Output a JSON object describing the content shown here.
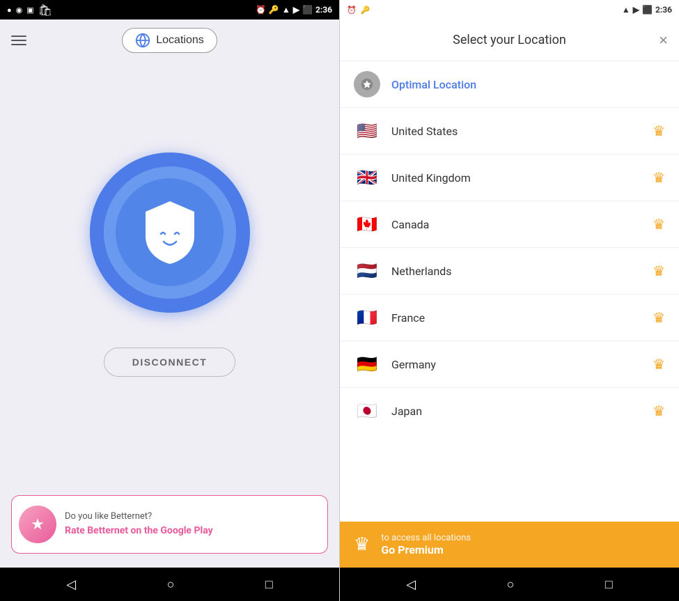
{
  "statusBar": {
    "time": "2:36",
    "leftIcons": [
      "●",
      "◉",
      "▣",
      "🛍"
    ],
    "rightIcons": [
      "⏰",
      "🔑",
      "▲",
      "▶",
      "⬛",
      "2:36"
    ]
  },
  "leftPanel": {
    "title": "Locations",
    "disconnectLabel": "DISCONNECT",
    "rating": {
      "text": "Do you like Betternet?",
      "linkText": "Rate Betternet on the Google Play"
    }
  },
  "rightPanel": {
    "title": "Select your Location",
    "closeLabel": "×",
    "locations": [
      {
        "id": "optimal",
        "name": "Optimal Location",
        "flag": "optimal",
        "premium": false
      },
      {
        "id": "us",
        "name": "United States",
        "flag": "🇺🇸",
        "premium": true
      },
      {
        "id": "uk",
        "name": "United Kingdom",
        "flag": "🇬🇧",
        "premium": true
      },
      {
        "id": "ca",
        "name": "Canada",
        "flag": "🇨🇦",
        "premium": true
      },
      {
        "id": "nl",
        "name": "Netherlands",
        "flag": "🇳🇱",
        "premium": true
      },
      {
        "id": "fr",
        "name": "France",
        "flag": "🇫🇷",
        "premium": true
      },
      {
        "id": "de",
        "name": "Germany",
        "flag": "🇩🇪",
        "premium": true
      },
      {
        "id": "jp",
        "name": "Japan",
        "flag": "🇯🇵",
        "premium": true
      }
    ],
    "premium": {
      "subtext": "to access all locations",
      "cta": "Go Premium"
    }
  },
  "navBar": {
    "back": "◁",
    "home": "○",
    "square": "□"
  }
}
